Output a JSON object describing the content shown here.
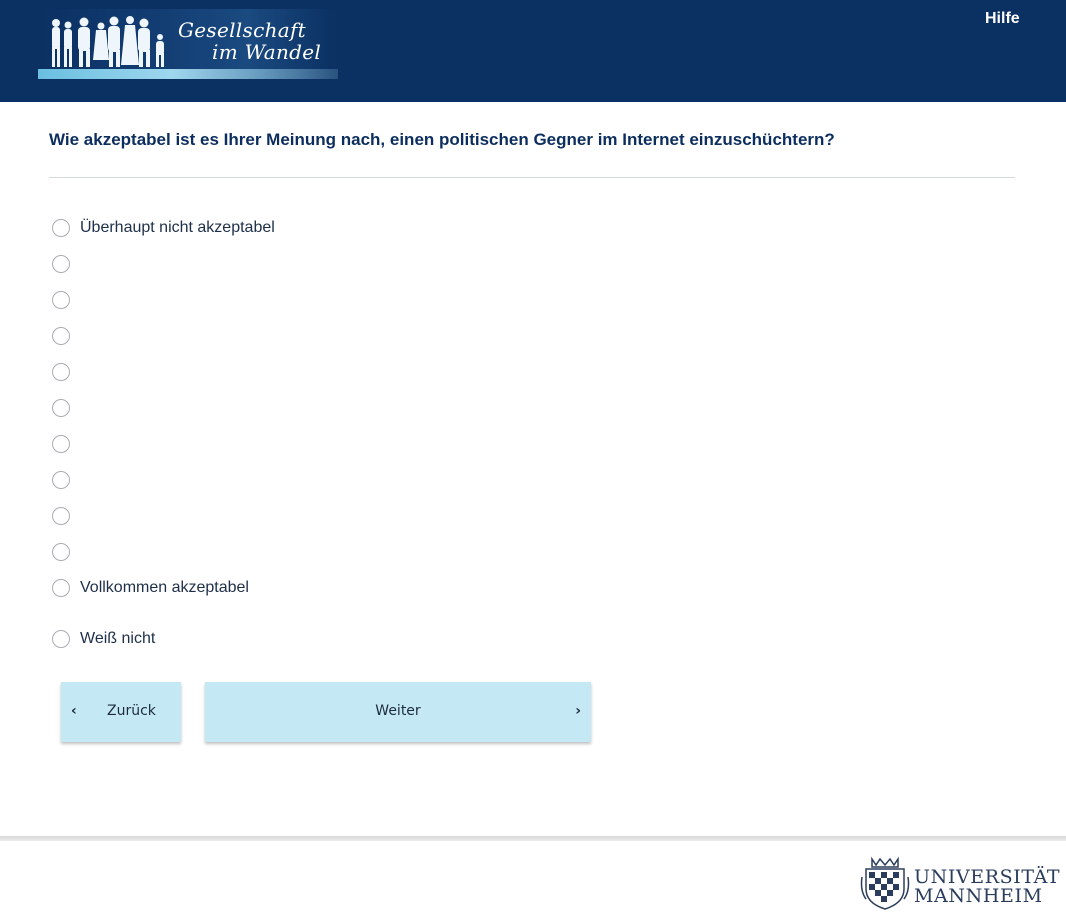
{
  "header": {
    "logo_line1": "Gesellschaft",
    "logo_line2": "im Wandel",
    "help_label": "Hilfe"
  },
  "question": {
    "text": "Wie akzeptabel ist es Ihrer Meinung nach, einen politischen Gegner im Internet einzuschüchtern?",
    "options": [
      {
        "label": "Überhaupt nicht akzeptabel",
        "selected": false
      },
      {
        "label": "",
        "selected": false
      },
      {
        "label": "",
        "selected": false
      },
      {
        "label": "",
        "selected": false
      },
      {
        "label": "",
        "selected": false
      },
      {
        "label": "",
        "selected": false
      },
      {
        "label": "",
        "selected": false
      },
      {
        "label": "",
        "selected": false
      },
      {
        "label": "",
        "selected": false
      },
      {
        "label": "",
        "selected": false
      },
      {
        "label": "Vollkommen akzeptabel",
        "selected": false
      },
      {
        "label": "Weiß nicht",
        "selected": false
      }
    ]
  },
  "navigation": {
    "back_label": "Zurück",
    "next_label": "Weiter",
    "back_icon": "chevron-left-icon",
    "next_icon": "chevron-right-icon"
  },
  "footer": {
    "university_line1": "UNIVERSITÄT",
    "university_line2": "MANNHEIM"
  },
  "colors": {
    "header_bg": "#0b3062",
    "title_text": "#0c2e5e",
    "button_bg": "#c5e8f5"
  }
}
